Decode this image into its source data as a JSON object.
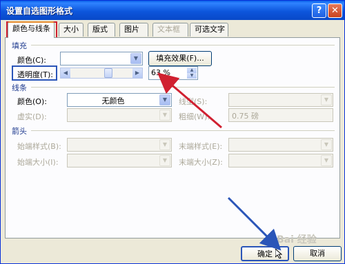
{
  "window": {
    "title": "设置自选图形格式"
  },
  "tabs": [
    {
      "label": "颜色与线条",
      "active": true,
      "enabled": true
    },
    {
      "label": "大小",
      "enabled": true
    },
    {
      "label": "版式",
      "enabled": true
    },
    {
      "label": "图片",
      "enabled": true
    },
    {
      "label": "文本框",
      "enabled": false
    },
    {
      "label": "可选文字",
      "enabled": true
    }
  ],
  "fill": {
    "section_label": "填充",
    "color_label": "颜色(C):",
    "color_value": "",
    "fill_effects_button": "填充效果(F)...",
    "transparency_label": "透明度(T):",
    "transparency_value": "63 %",
    "transparency_fraction": 0.63
  },
  "line": {
    "section_label": "线条",
    "color_label": "颜色(O):",
    "color_value": "无颜色",
    "style_label": "线型(S):",
    "dashed_label": "虚实(D):",
    "weight_label": "粗细(W):",
    "weight_value": "0.75 磅"
  },
  "arrows": {
    "section_label": "箭头",
    "begin_style_label": "始端样式(B):",
    "end_style_label": "末端样式(E):",
    "begin_size_label": "始端大小(I):",
    "end_size_label": "末端大小(Z):"
  },
  "buttons": {
    "ok": "确定",
    "cancel": "取消"
  },
  "watermark": "Bai 经验",
  "annotation_colors": {
    "red": "#d02030",
    "blue": "#2a55b8"
  }
}
